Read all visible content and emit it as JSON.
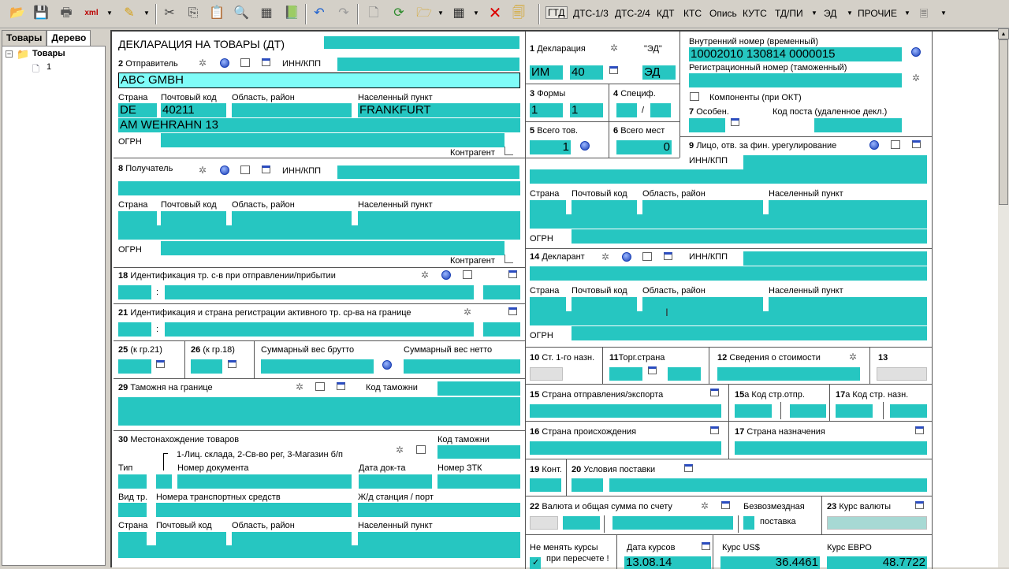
{
  "toolbar": {
    "gtd": "ГТД",
    "dts13": "ДТС-1/3",
    "dts24": "ДТС-2/4",
    "kdt": "КДТ",
    "kts": "КТС",
    "opis": "Опись",
    "kuts": "КУТС",
    "tdpi": "ТД/ПИ",
    "ed": "ЭД",
    "prochie": "ПРОЧИЕ"
  },
  "left": {
    "tabs": [
      "Товары",
      "Дерево"
    ],
    "tree_root": "Товары",
    "tree_child": "1"
  },
  "form": {
    "title": "ДЕКЛАРАЦИЯ НА ТОВАРЫ (ДТ)",
    "b2": {
      "num": "2",
      "label": "Отправитель",
      "inn": "ИНН/КПП",
      "name": "ABC GMBH",
      "strana": "Страна",
      "pochta": "Почтовый код",
      "oblast": "Область, район",
      "punkt": "Населенный пункт",
      "country": "DE",
      "zip": "40211",
      "city": "FRANKFURT",
      "street": "AM WEHRAHN 13",
      "ogrn": "ОГРН",
      "kontragent": "Контрагент"
    },
    "b8": {
      "num": "8",
      "label": "Получатель",
      "inn": "ИНН/КПП",
      "strana": "Страна",
      "pochta": "Почтовый код",
      "oblast": "Область, район",
      "punkt": "Населенный пункт",
      "ogrn": "ОГРН",
      "kontragent": "Контрагент"
    },
    "b18": {
      "num": "18",
      "label": "Идентификация тр. с-в при отправлении/прибытии"
    },
    "b21": {
      "num": "21",
      "label": "Идентификация и страна регистрации активного тр. ср-ва на границе"
    },
    "b25": {
      "num": "25",
      "label": "(к гр.21)"
    },
    "b26": {
      "num": "26",
      "label": "(к гр.18)"
    },
    "brutto": "Суммарный вес брутто",
    "netto": "Суммарный вес нетто",
    "b29": {
      "num": "29",
      "label": "Таможня на границе",
      "kod": "Код таможни"
    },
    "b30": {
      "num": "30",
      "label": "Местонахождение товаров",
      "kod": "Код таможни",
      "hint": "1-Лиц. склада, 2-Св-во рег, 3-Магазин б/п",
      "tip": "Тип",
      "nomer": "Номер документа",
      "data": "Дата док-та",
      "nomer_ztk": "Номер ЗТК",
      "vid": "Вид тр.",
      "nomera_ts": "Номера транспортных средств",
      "zd": "Ж/д станция / порт",
      "strana": "Страна",
      "pochta": "Почтовый код",
      "oblast": "Область, район",
      "punkt": "Населенный пункт"
    },
    "b1": {
      "num": "1",
      "label": "Декларация",
      "ed_q": "\"ЭД\"",
      "im": "ИМ",
      "code": "40",
      "ed": "ЭД"
    },
    "b3": {
      "num": "3",
      "label": "Формы",
      "v1": "1",
      "v2": "1"
    },
    "b4": {
      "num": "4",
      "label": "Специф.",
      "slash": "/"
    },
    "b5": {
      "num": "5",
      "label": "Всего тов.",
      "value": "1"
    },
    "b6": {
      "num": "6",
      "label": "Всего мест",
      "value": "0"
    },
    "internal": {
      "label": "Внутренний номер (временный)",
      "value": "10002010 130814 0000015",
      "reg": "Регистрационный номер (таможенный)",
      "komp": "Компоненты (при ОКТ)"
    },
    "b7": {
      "num": "7",
      "label": "Особен.",
      "post": "Код поста (удаленное декл.)"
    },
    "b9": {
      "num": "9",
      "label": "Лицо, отв. за фин. урегулирование",
      "inn": "ИНН/КПП",
      "strana": "Страна",
      "pochta": "Почтовый код",
      "oblast": "Область, район",
      "punkt": "Населенный пункт",
      "ogrn": "ОГРН"
    },
    "b14": {
      "num": "14",
      "label": "Декларант",
      "inn": "ИНН/КПП",
      "strana": "Страна",
      "pochta": "Почтовый код",
      "oblast": "Область, район",
      "punkt": "Населенный пункт",
      "ogrn": "ОГРН"
    },
    "b10": {
      "num": "10",
      "label": "Ст. 1-го назн."
    },
    "b11": {
      "num": "11",
      "label": "Торг.страна"
    },
    "b12": {
      "num": "12",
      "label": "Сведения о стоимости"
    },
    "b13": {
      "num": "13"
    },
    "b15": {
      "num": "15",
      "label": "Страна отправления/экспорта"
    },
    "b15a": {
      "num": "15",
      "suffix": "а Код стр.отпр."
    },
    "b17a": {
      "num": "17",
      "suffix": "а Код стр. назн."
    },
    "b16": {
      "num": "16",
      "label": "Страна происхождения"
    },
    "b17": {
      "num": "17",
      "label": "Страна назначения"
    },
    "b19": {
      "num": "19",
      "label": "Конт."
    },
    "b20": {
      "num": "20",
      "label": "Условия поставки"
    },
    "b22": {
      "num": "22",
      "label": "Валюта и общая сумма по счету",
      "bezv1": "Безвозмездная",
      "bezv2": "поставка"
    },
    "b23": {
      "num": "23",
      "label": "Курс валюты"
    },
    "rates": {
      "nemen1": "Не менять курсы",
      "nemen2": "при пересчете !",
      "data_label": "Дата курсов",
      "date": "13.08.14",
      "usd_label": "Курс US$",
      "usd": "36.4461",
      "eur_label": "Курс ЕВРО",
      "eur": "48.7722"
    }
  }
}
